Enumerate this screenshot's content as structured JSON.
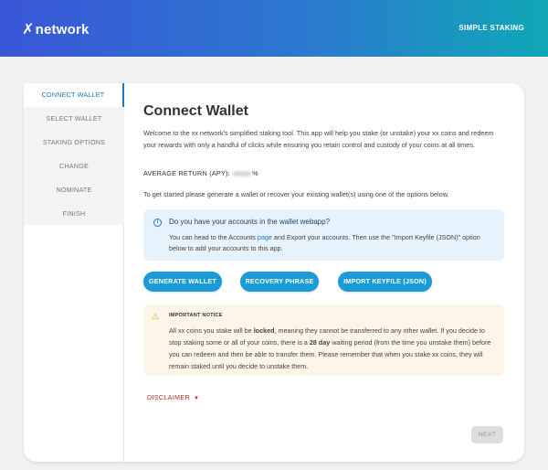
{
  "header": {
    "logo_text": "network",
    "nav_label": "SIMPLE STAKING"
  },
  "sidebar": {
    "steps": [
      {
        "label": "CONNECT WALLET",
        "active": true
      },
      {
        "label": "SELECT WALLET",
        "active": false
      },
      {
        "label": "STAKING OPTIONS",
        "active": false
      },
      {
        "label": "CHANGE",
        "active": false
      },
      {
        "label": "NOMINATE",
        "active": false
      },
      {
        "label": "FINISH",
        "active": false
      }
    ]
  },
  "main": {
    "title": "Connect Wallet",
    "intro": "Welcome to the xx network's simplified staking tool. This app will help you stake (or unstake) your xx coins and redeem your rewards with only a handful of clicks while ensuring you retain control and custody of your coins at all times.",
    "apy_label": "AVERAGE RETURN (APY):",
    "apy_suffix": "%",
    "get_started": "To get started please generate a wallet or recover your existing wallet(s) using one of the options below.",
    "info": {
      "title": "Do you have your accounts in the wallet webapp?",
      "text_before": "You can head to the Accounts ",
      "link": "page",
      "text_after": " and Export your accounts. Then use the \"Import Keyfile (JSON)\" option below to add your accounts to this app."
    },
    "buttons": {
      "generate": "GENERATE WALLET",
      "recovery": "RECOVERY PHRASE",
      "import": "IMPORT KEYFILE (JSON)"
    },
    "notice": {
      "title": "IMPORTANT NOTICE",
      "p1": "All xx coins you stake will be ",
      "p1_bold": "locked",
      "p2": ", meaning they cannot be transferred to any other wallet. If you decide to stop staking some or all of your coins, there is a ",
      "p2_bold": "28 day",
      "p3": " waiting period (from the time you unstake them) before you can redeem and then be able to transfer them. Please remember that when you stake xx coins, they will remain staked until you decide to unstake them."
    },
    "disclaimer": "DISCLAIMER",
    "next": "NEXT"
  },
  "colors": {
    "accent": "#1a9ad6",
    "active_step": "#1a78c2",
    "disclaimer": "#b32b2b",
    "warning": "#e4a21b"
  },
  "icons": {
    "logo": "xx-logo-icon",
    "info": "info-icon",
    "warning": "warning-icon",
    "chevron": "chevron-down-icon"
  }
}
